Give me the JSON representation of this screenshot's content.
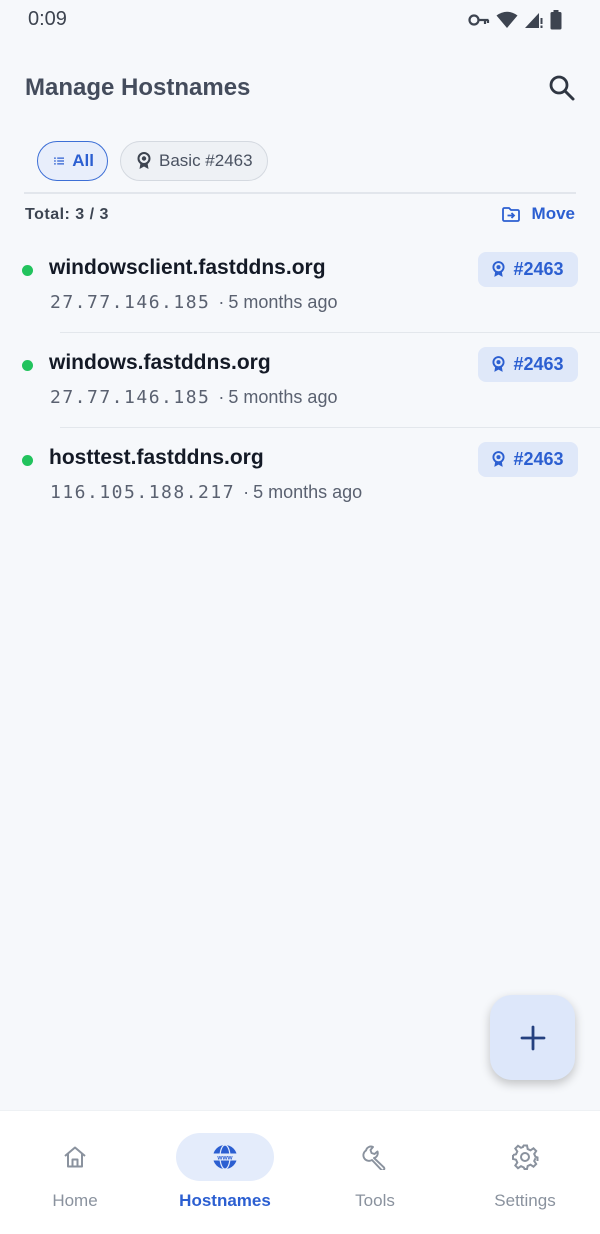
{
  "status_bar": {
    "time": "0:09",
    "icons": [
      "vpn-key-icon",
      "wifi-icon",
      "signal-icon",
      "battery-icon"
    ]
  },
  "header": {
    "title": "Manage Hostnames",
    "search_icon": "search-icon"
  },
  "filters": {
    "all_label": "All",
    "plan_label": "Basic #2463"
  },
  "summary": {
    "total": "Total: 3 / 3",
    "move_label": "Move"
  },
  "hostnames": [
    {
      "name": "windowsclient.fastddns.org",
      "ip": "27.77.146.185",
      "separator": "·",
      "age": "5 months ago",
      "badge": "#2463",
      "status": "online"
    },
    {
      "name": "windows.fastddns.org",
      "ip": "27.77.146.185",
      "separator": "·",
      "age": "5 months ago",
      "badge": "#2463",
      "status": "online"
    },
    {
      "name": "hosttest.fastddns.org",
      "ip": "116.105.188.217",
      "separator": "·",
      "age": "5 months ago",
      "badge": "#2463",
      "status": "online"
    }
  ],
  "fab": {
    "icon": "plus-icon"
  },
  "nav": {
    "active": "Hostnames",
    "items": [
      {
        "label": "Home",
        "icon": "home-icon"
      },
      {
        "label": "Hostnames",
        "icon": "www-globe-icon"
      },
      {
        "label": "Tools",
        "icon": "wrench-icon"
      },
      {
        "label": "Settings",
        "icon": "gear-icon"
      }
    ]
  },
  "colors": {
    "accent": "#2c5fd1",
    "online_dot": "#22c35d",
    "background": "#f6f8fb",
    "badge_bg": "#dfe8f9"
  }
}
